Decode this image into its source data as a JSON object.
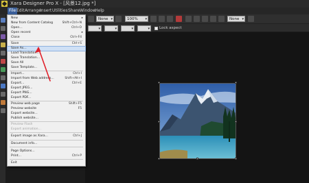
{
  "window": {
    "title": "Xara Designer Pro X - [风景12.jpg *]"
  },
  "menubar": {
    "items": [
      "File",
      "Edit",
      "Arrange",
      "Insert",
      "Utilities",
      "Share",
      "Window",
      "Help"
    ],
    "active": "File"
  },
  "toolbar": {
    "style_select": "None",
    "zoom_value": "100%",
    "page_select": "None",
    "lock_aspect_label": "Lock aspect"
  },
  "file_menu": {
    "items": [
      {
        "label": "New",
        "shortcut": "",
        "submenu": true
      },
      {
        "label": "New from Content Catalog",
        "shortcut": "Shift+Ctrl+N"
      },
      {
        "label": "Open...",
        "shortcut": "Ctrl+O"
      },
      {
        "label": "Open recent",
        "shortcut": "",
        "submenu": true
      },
      {
        "label": "Close",
        "shortcut": "Ctrl+F4"
      },
      {
        "label": "Save",
        "shortcut": "Ctrl+S"
      },
      {
        "label": "Save As...",
        "shortcut": ""
      },
      {
        "label": "Load Translation...",
        "shortcut": ""
      },
      {
        "label": "Save Translation...",
        "shortcut": ""
      },
      {
        "label": "Save All",
        "shortcut": ""
      },
      {
        "label": "Save Template...",
        "shortcut": ""
      },
      {
        "label": "Import...",
        "shortcut": "Ctrl+I"
      },
      {
        "label": "Import from Web address...",
        "shortcut": "Shift+Alt+I"
      },
      {
        "label": "Export...",
        "shortcut": "Ctrl+E"
      },
      {
        "label": "Export JPEG...",
        "shortcut": ""
      },
      {
        "label": "Export PNG...",
        "shortcut": ""
      },
      {
        "label": "Export PDF...",
        "shortcut": ""
      },
      {
        "label": "Preview web page",
        "shortcut": "Shift+F5"
      },
      {
        "label": "Preview website",
        "shortcut": "F5"
      },
      {
        "label": "Export website...",
        "shortcut": ""
      },
      {
        "label": "Publish website...",
        "shortcut": ""
      },
      {
        "label": "Preview Flash",
        "shortcut": "",
        "disabled": true
      },
      {
        "label": "Export animation...",
        "shortcut": "",
        "disabled": true
      },
      {
        "label": "Export image as Xara...",
        "shortcut": "Ctrl+J"
      },
      {
        "label": "Document info...",
        "shortcut": ""
      },
      {
        "label": "Page Options...",
        "shortcut": ""
      },
      {
        "label": "Print...",
        "shortcut": "Ctrl+P"
      },
      {
        "label": "Exit",
        "shortcut": ""
      }
    ],
    "highlighted": "Save As..."
  },
  "colors": {
    "menu_bg": "#f0f0f0",
    "highlight": "#cfe0f5",
    "annotation_arrow": "#e0202a",
    "app_bg": "#141414"
  }
}
